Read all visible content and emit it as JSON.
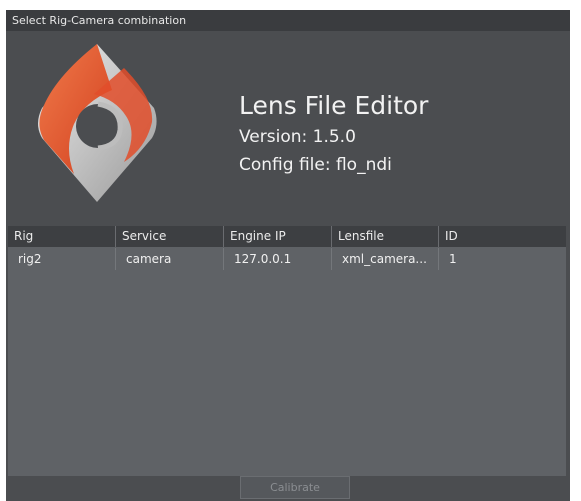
{
  "window": {
    "title": "Select Rig-Camera combination"
  },
  "header": {
    "app_name": "Lens File Editor",
    "version": "Version: 1.5.0",
    "config": "Config file: flo_ndi",
    "logo_colors": [
      "#e24d2a",
      "#c9c9c9",
      "#f07a4a"
    ]
  },
  "table": {
    "columns": [
      "Rig",
      "Service",
      "Engine IP",
      "Lensfile",
      "ID"
    ],
    "rows": [
      [
        "rig2",
        "camera",
        "127.0.0.1",
        "xml_camera...",
        "1"
      ]
    ]
  },
  "footer": {
    "calibrate_label": "Calibrate"
  }
}
